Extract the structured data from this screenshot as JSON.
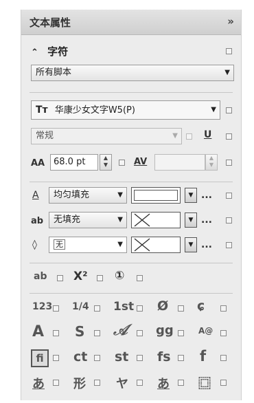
{
  "panel": {
    "title": "文本属性",
    "collapse_glyph": "»"
  },
  "section": {
    "chevron": "⌃",
    "title": "字符"
  },
  "script_select": {
    "value": "所有脚本"
  },
  "font": {
    "icon_glyph": "Tт",
    "name": "华康少女文字W5(P)"
  },
  "style": {
    "value": "常规",
    "underline_glyph": "U"
  },
  "size": {
    "icon_glyph": "AA",
    "value": "68.0 pt",
    "kerning_glyph": "AV"
  },
  "fill_rows": [
    {
      "icon": "fill-text-icon",
      "mode": "均匀填充",
      "swatch": "white"
    },
    {
      "icon": "outline-text-icon",
      "mode": "无填充",
      "swatch": "none",
      "icon_text": "ab"
    },
    {
      "icon": "background-fill-icon",
      "mode": "无",
      "swatch": "none"
    }
  ],
  "more_glyph": "...",
  "opentype_row1": [
    {
      "name": "small-caps-icon",
      "glyph": "ab"
    },
    {
      "name": "superscript-icon",
      "glyph": "X²"
    },
    {
      "name": "ordinal-circle-icon",
      "glyph": "①"
    }
  ],
  "feature_grid": [
    [
      "123",
      "1/4",
      "1st",
      "0",
      "ɕ"
    ],
    [
      "A",
      "S",
      "𝒜",
      "gg",
      "A@"
    ],
    [
      "fi",
      "ct",
      "st",
      "fs",
      "f"
    ],
    [
      "あ",
      "形",
      "ヤ",
      "あ",
      "⿴"
    ]
  ]
}
